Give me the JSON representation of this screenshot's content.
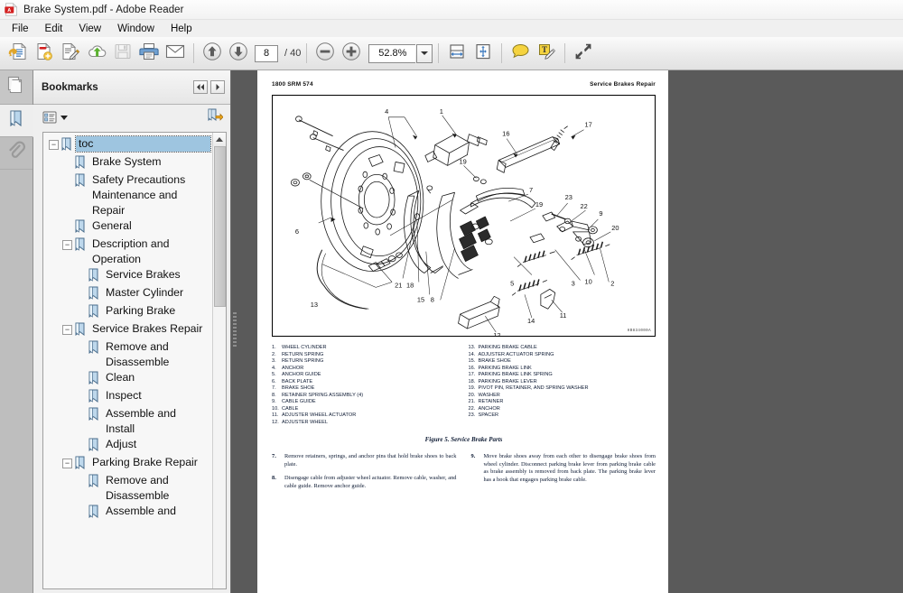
{
  "window": {
    "title": "Brake System.pdf - Adobe Reader",
    "app_icon": "pdf-document-icon"
  },
  "menubar": {
    "items": [
      {
        "label": "File"
      },
      {
        "label": "Edit"
      },
      {
        "label": "View"
      },
      {
        "label": "Window"
      },
      {
        "label": "Help"
      }
    ]
  },
  "toolbar": {
    "buttons": [
      {
        "name": "open-file-icon",
        "tooltip": "Open"
      },
      {
        "name": "create-pdf-icon",
        "tooltip": "Create PDF"
      },
      {
        "name": "edit-pdf-icon",
        "tooltip": "Edit PDF"
      },
      {
        "name": "upload-cloud-icon",
        "tooltip": "Send Files"
      },
      {
        "name": "save-icon",
        "tooltip": "Save",
        "disabled": true
      },
      {
        "name": "print-icon",
        "tooltip": "Print"
      },
      {
        "name": "email-icon",
        "tooltip": "Email"
      }
    ],
    "page_up_icon": "arrow-up-icon",
    "page_down_icon": "arrow-down-icon",
    "page_number": "8",
    "page_total": "/ 40",
    "zoom_out_icon": "minus-circle-icon",
    "zoom_in_icon": "plus-circle-icon",
    "zoom_value": "52.8%",
    "zoom_dropdown_icon": "chevron-down-icon",
    "fit_width_icon": "fit-width-icon",
    "fit_page_icon": "fit-page-icon",
    "comment_icon": "comment-balloon-icon",
    "text_edit_icon": "text-markup-icon",
    "fullscreen_icon": "expand-fullscreen-icon"
  },
  "rail": {
    "items": [
      {
        "name": "page-thumbnails-icon",
        "label": "Page Thumbnails",
        "active": false
      },
      {
        "name": "bookmarks-icon",
        "label": "Bookmarks",
        "active": true
      },
      {
        "name": "attachments-icon",
        "label": "Attachments",
        "active": false
      }
    ]
  },
  "bookmarks_panel": {
    "title": "Bookmarks",
    "prev_icon": "nav-prev-icon",
    "next_icon": "nav-next-icon",
    "options_icon": "options-list-icon",
    "options_caret_icon": "chevron-down-icon",
    "new_bookmark_icon": "new-bookmark-icon",
    "scroll_up_icon": "caret-up-icon",
    "tree": [
      {
        "label": "toc",
        "level": 0,
        "expandable": true,
        "expanded": true,
        "selected": true
      },
      {
        "label": "Brake System",
        "level": 1,
        "expandable": false,
        "selected": false
      },
      {
        "label": "Safety Precautions Maintenance and Repair",
        "level": 1,
        "expandable": false,
        "selected": false
      },
      {
        "label": "General",
        "level": 1,
        "expandable": false,
        "selected": false
      },
      {
        "label": "Description and Operation",
        "level": 1,
        "expandable": true,
        "expanded": true,
        "selected": false
      },
      {
        "label": "Service Brakes",
        "level": 2,
        "expandable": false,
        "selected": false
      },
      {
        "label": "Master Cylinder",
        "level": 2,
        "expandable": false,
        "selected": false
      },
      {
        "label": "Parking Brake",
        "level": 2,
        "expandable": false,
        "selected": false
      },
      {
        "label": "Service Brakes Repair",
        "level": 1,
        "expandable": true,
        "expanded": true,
        "selected": false
      },
      {
        "label": "Remove and Disassemble",
        "level": 2,
        "expandable": false,
        "selected": false
      },
      {
        "label": "Clean",
        "level": 2,
        "expandable": false,
        "selected": false
      },
      {
        "label": "Inspect",
        "level": 2,
        "expandable": false,
        "selected": false
      },
      {
        "label": "Assemble and Install",
        "level": 2,
        "expandable": false,
        "selected": false
      },
      {
        "label": "Adjust",
        "level": 2,
        "expandable": false,
        "selected": false
      },
      {
        "label": "Parking Brake Repair",
        "level": 1,
        "expandable": true,
        "expanded": true,
        "selected": false
      },
      {
        "label": "Remove and Disassemble",
        "level": 2,
        "expandable": false,
        "selected": false
      },
      {
        "label": "Assemble and",
        "level": 2,
        "expandable": false,
        "selected": false
      }
    ]
  },
  "document": {
    "header_left": "1800 SRM 574",
    "header_right": "Service Brakes Repair",
    "drawing_code": "HB834000A",
    "figure_caption": "Figure 5.  Service Brake Parts",
    "legend_left": [
      {
        "num": "1.",
        "text": "WHEEL CYLINDER"
      },
      {
        "num": "2.",
        "text": "RETURN SPRING"
      },
      {
        "num": "3.",
        "text": "RETURN SPRING"
      },
      {
        "num": "4.",
        "text": "ANCHOR"
      },
      {
        "num": "5.",
        "text": "ANCHOR GUIDE"
      },
      {
        "num": "6.",
        "text": "BACK PLATE"
      },
      {
        "num": "7.",
        "text": "BRAKE SHOE"
      },
      {
        "num": "8.",
        "text": "RETAINER SPRING ASSEMBLY (4)"
      },
      {
        "num": "9.",
        "text": "CABLE GUIDE"
      },
      {
        "num": "10.",
        "text": "CABLE"
      },
      {
        "num": "11.",
        "text": "ADJUSTER WHEEL ACTUATOR"
      },
      {
        "num": "12.",
        "text": "ADJUSTER WHEEL"
      }
    ],
    "legend_right": [
      {
        "num": "13.",
        "text": "PARKING BRAKE CABLE"
      },
      {
        "num": "14.",
        "text": "ADJUSTER ACTUATOR SPRING"
      },
      {
        "num": "15.",
        "text": "BRAKE SHOE"
      },
      {
        "num": "16.",
        "text": "PARKING BRAKE LINK"
      },
      {
        "num": "17.",
        "text": "PARKING BRAKE LINK SPRING"
      },
      {
        "num": "18.",
        "text": "PARKING BRAKE LEVER"
      },
      {
        "num": "19.",
        "text": "PIVOT PIN, RETAINER, AND SPRING WASHER"
      },
      {
        "num": "20.",
        "text": "WASHER"
      },
      {
        "num": "21.",
        "text": "RETAINER"
      },
      {
        "num": "22.",
        "text": "ANCHOR"
      },
      {
        "num": "23.",
        "text": "SPACER"
      }
    ],
    "steps_left": [
      {
        "num": "7.",
        "text": "Remove retainers, springs, and anchor pins that hold brake shoes to back plate."
      },
      {
        "num": "8.",
        "text": "Disengage cable from adjuster wheel actuator. Remove cable, washer, and cable guide. Remove anchor guide."
      }
    ],
    "steps_right": [
      {
        "num": "9.",
        "text": "Move brake shoes away from each other to disengage brake shoes from wheel cylinder. Disconnect parking brake lever from parking brake cable as brake assembly is removed from back plate. The parking brake lever has a hook that engages parking brake cable."
      }
    ],
    "figure_callouts": [
      "1",
      "2",
      "3",
      "4",
      "5",
      "6",
      "7",
      "8",
      "9",
      "10",
      "11",
      "12",
      "13",
      "14",
      "15",
      "16",
      "17",
      "18",
      "19",
      "19",
      "20",
      "21",
      "22",
      "23"
    ]
  },
  "colors": {
    "titlebar": "#fdfdfd",
    "toolbar": "#eaeaea",
    "rail": "#bebebe",
    "panel": "#efefef",
    "viewer_backdrop": "#5a5a5a",
    "selection": "#9ec5e0",
    "page": "#ffffff"
  }
}
